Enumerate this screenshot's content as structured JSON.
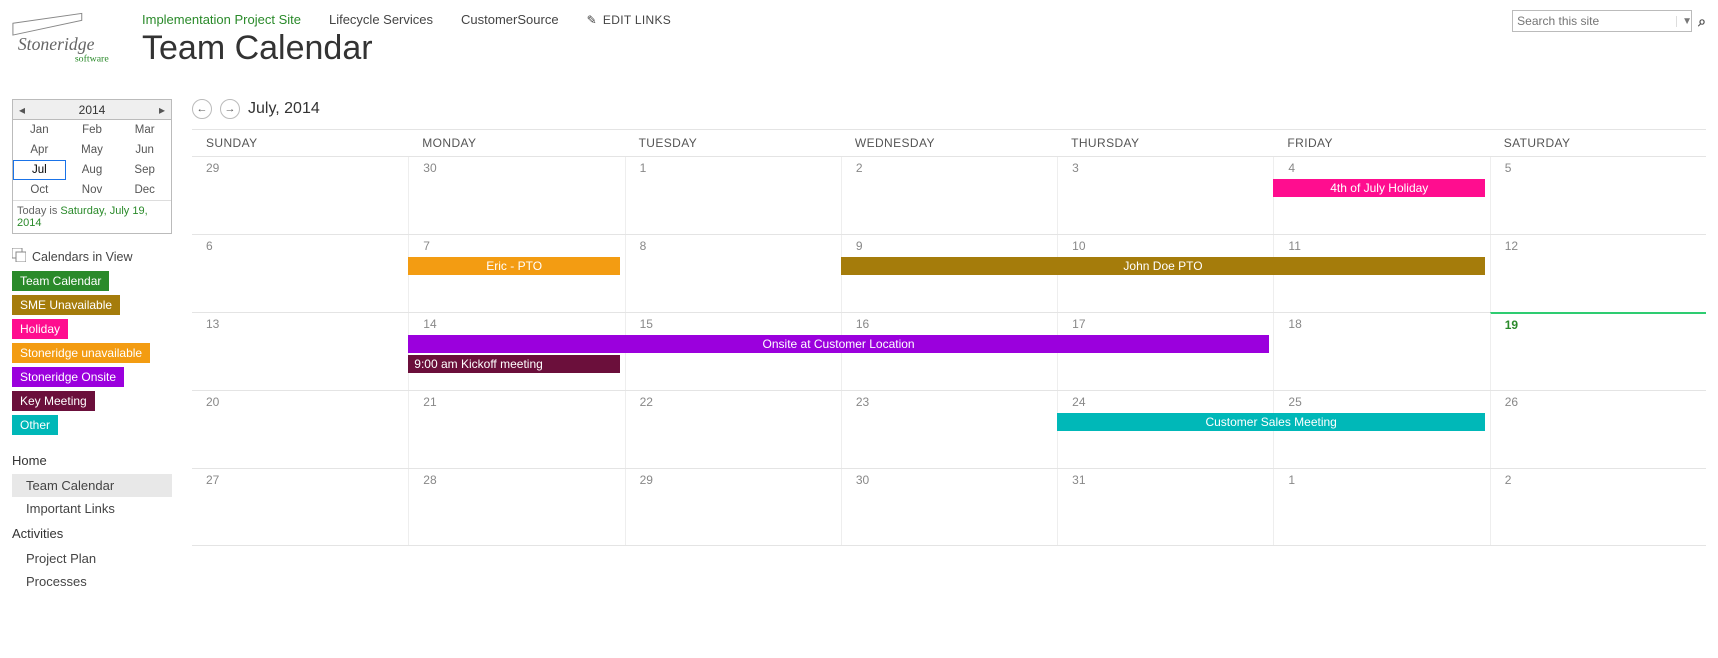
{
  "header": {
    "nav": {
      "implementation": "Implementation Project Site",
      "lifecycle": "Lifecycle Services",
      "customersource": "CustomerSource",
      "edit_links": "EDIT LINKS"
    },
    "title": "Team Calendar",
    "search_placeholder": "Search this site"
  },
  "mini_cal": {
    "year": "2014",
    "months": [
      "Jan",
      "Feb",
      "Mar",
      "Apr",
      "May",
      "Jun",
      "Jul",
      "Aug",
      "Sep",
      "Oct",
      "Nov",
      "Dec"
    ],
    "selected": "Jul",
    "today_prefix": "Today is ",
    "today_date": "Saturday, July 19, 2014"
  },
  "civ": {
    "heading": "Calendars in View",
    "items": [
      {
        "label": "Team Calendar",
        "color": "#2a8a2a"
      },
      {
        "label": "SME Unavailable",
        "color": "#a57c0b"
      },
      {
        "label": "Holiday",
        "color": "#ff0d8f"
      },
      {
        "label": "Stoneridge unavailable",
        "color": "#f39c12"
      },
      {
        "label": "Stoneridge Onsite",
        "color": "#9b00dd"
      },
      {
        "label": "Key Meeting",
        "color": "#6b0f3b"
      },
      {
        "label": "Other",
        "color": "#00b8b8"
      }
    ]
  },
  "leftnav": {
    "home": "Home",
    "team_calendar": "Team Calendar",
    "important_links": "Important Links",
    "activities": "Activities",
    "project_plan": "Project Plan",
    "processes": "Processes"
  },
  "calendar": {
    "title": "July, 2014",
    "dow": [
      "SUNDAY",
      "MONDAY",
      "TUESDAY",
      "WEDNESDAY",
      "THURSDAY",
      "FRIDAY",
      "SATURDAY"
    ],
    "weeks": [
      [
        "29",
        "30",
        "1",
        "2",
        "3",
        "4",
        "5"
      ],
      [
        "6",
        "7",
        "8",
        "9",
        "10",
        "11",
        "12"
      ],
      [
        "13",
        "14",
        "15",
        "16",
        "17",
        "18",
        "19"
      ],
      [
        "20",
        "21",
        "22",
        "23",
        "24",
        "25",
        "26"
      ],
      [
        "27",
        "28",
        "29",
        "30",
        "31",
        "1",
        "2"
      ]
    ],
    "today": {
      "week": 2,
      "col": 6
    },
    "events": [
      {
        "week": 0,
        "row": 0,
        "start": 5,
        "span": 1,
        "label": "4th of July Holiday",
        "color": "#ff0d8f"
      },
      {
        "week": 1,
        "row": 0,
        "start": 1,
        "span": 1,
        "label": "Eric - PTO",
        "color": "#f39c12"
      },
      {
        "week": 1,
        "row": 0,
        "start": 3,
        "span": 3,
        "label": "John Doe PTO",
        "color": "#a57c0b"
      },
      {
        "week": 2,
        "row": 0,
        "start": 1,
        "span": 4,
        "label": "Onsite at Customer Location",
        "color": "#9b00dd"
      },
      {
        "week": 2,
        "row": 1,
        "start": 1,
        "span": 1,
        "label": "9:00 am Kickoff meeting",
        "color": "#6b0f3b",
        "align": "left"
      },
      {
        "week": 3,
        "row": 0,
        "start": 4,
        "span": 2,
        "label": "Customer Sales Meeting",
        "color": "#00b8b8"
      }
    ]
  }
}
